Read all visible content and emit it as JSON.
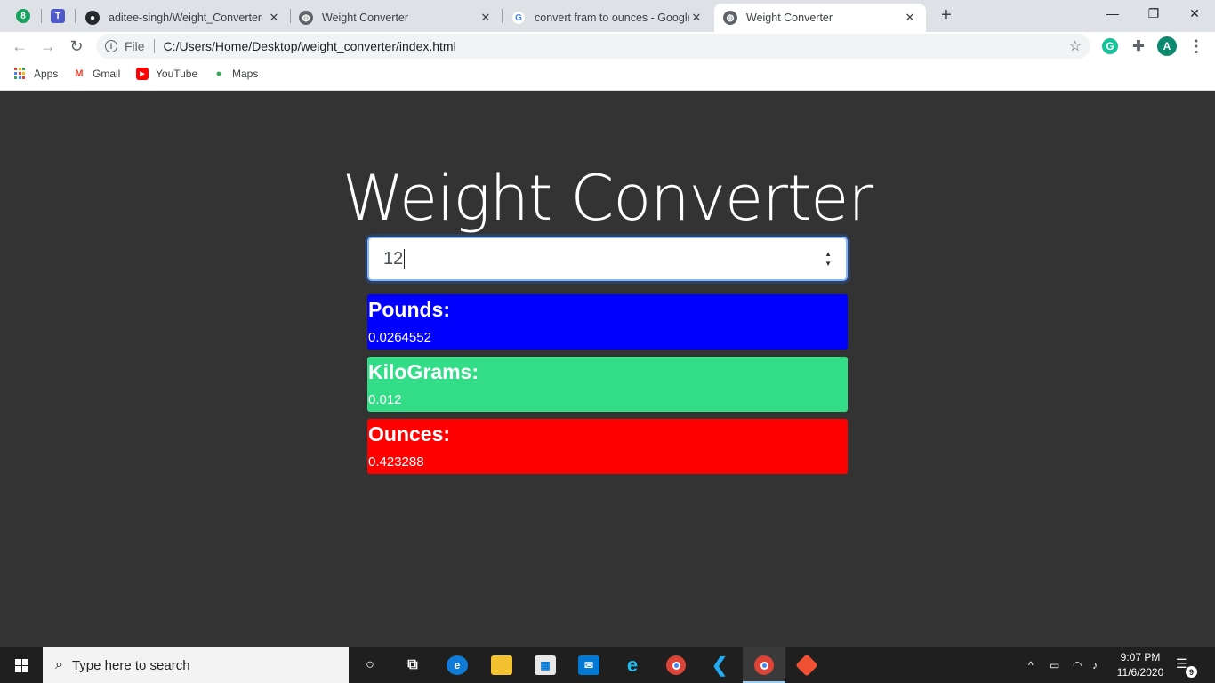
{
  "browser": {
    "pinned_badge": "8",
    "pinned_teams": "T",
    "tabs": [
      {
        "title": "aditee-singh/Weight_Converter",
        "favicon": "github-icon"
      },
      {
        "title": "Weight Converter",
        "favicon": "globe-icon"
      },
      {
        "title": "convert fram to ounces - Google",
        "favicon": "google-icon"
      },
      {
        "title": "Weight Converter",
        "favicon": "globe-icon"
      }
    ],
    "address": {
      "scheme_label": "File",
      "url": "C:/Users/Home/Desktop/weight_converter/index.html"
    },
    "profile_initial": "A",
    "grammarly_initial": "G",
    "bookmarks": [
      {
        "label": "Apps"
      },
      {
        "label": "Gmail"
      },
      {
        "label": "YouTube"
      },
      {
        "label": "Maps"
      }
    ]
  },
  "page": {
    "title": "Weight Converter",
    "input_value": "12",
    "results": [
      {
        "label": "Pounds:",
        "value": "0.0264552",
        "color": "#0000ff"
      },
      {
        "label": "KiloGrams:",
        "value": "0.012",
        "color": "#33dd88"
      },
      {
        "label": "Ounces:",
        "value": "0.423288",
        "color": "#ff0000"
      }
    ]
  },
  "taskbar": {
    "search_placeholder": "Type here to search",
    "time": "9:07 PM",
    "date": "11/6/2020",
    "notification_count": "9"
  },
  "colors": {
    "page_bg": "#333333",
    "taskbar_bg": "#1f1f1f",
    "tabstrip_bg": "#dee1e6"
  }
}
